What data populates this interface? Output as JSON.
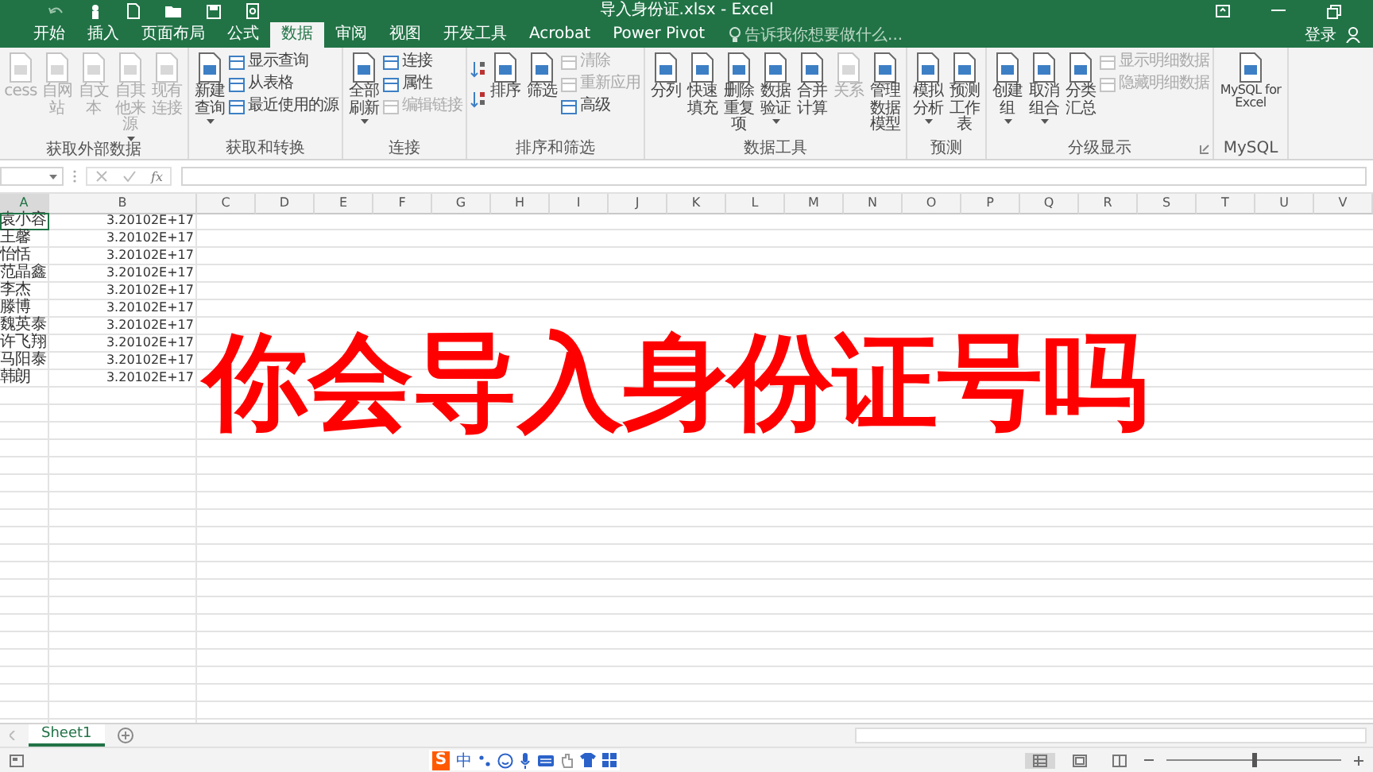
{
  "window": {
    "title": "导入身份证.xlsx - Excel"
  },
  "tabs": [
    {
      "label": "开始",
      "selected": false
    },
    {
      "label": "插入",
      "selected": false
    },
    {
      "label": "页面布局",
      "selected": false
    },
    {
      "label": "公式",
      "selected": false
    },
    {
      "label": "数据",
      "selected": true
    },
    {
      "label": "审阅",
      "selected": false
    },
    {
      "label": "视图",
      "selected": false
    },
    {
      "label": "开发工具",
      "selected": false
    },
    {
      "label": "Acrobat",
      "selected": false
    },
    {
      "label": "Power Pivot",
      "selected": false
    }
  ],
  "tell_me": {
    "placeholder": "告诉我你想要做什么..."
  },
  "sign_in": "登录",
  "ribbon": {
    "groups": [
      {
        "label": "获取外部数据",
        "items": [
          {
            "kind": "large",
            "label": "cess",
            "disabled": true
          },
          {
            "kind": "large",
            "label": "自网站",
            "disabled": true
          },
          {
            "kind": "large",
            "label": "自文本",
            "disabled": true
          },
          {
            "kind": "large",
            "label": "自其他来源",
            "disabled": true,
            "caret": true
          },
          {
            "kind": "large",
            "label": "现有连接",
            "disabled": true
          }
        ]
      },
      {
        "label": "获取和转换",
        "items": [
          {
            "kind": "large",
            "label": "新建查询",
            "disabled": false,
            "caret": true
          },
          {
            "kind": "stack",
            "items": [
              {
                "label": "显示查询",
                "disabled": false
              },
              {
                "label": "从表格",
                "disabled": false
              },
              {
                "label": "最近使用的源",
                "disabled": false
              }
            ]
          }
        ]
      },
      {
        "label": "连接",
        "items": [
          {
            "kind": "large",
            "label": "全部刷新",
            "disabled": false,
            "caret": true
          },
          {
            "kind": "stack",
            "items": [
              {
                "label": "连接",
                "disabled": false
              },
              {
                "label": "属性",
                "disabled": false
              },
              {
                "label": "编辑链接",
                "disabled": true
              }
            ]
          }
        ]
      },
      {
        "label": "排序和筛选",
        "items": [
          {
            "kind": "sort"
          },
          {
            "kind": "large",
            "label": "排序",
            "disabled": false
          },
          {
            "kind": "large",
            "label": "筛选",
            "disabled": false
          },
          {
            "kind": "stack",
            "items": [
              {
                "label": "清除",
                "disabled": true
              },
              {
                "label": "重新应用",
                "disabled": true
              },
              {
                "label": "高级",
                "disabled": false
              }
            ]
          }
        ]
      },
      {
        "label": "数据工具",
        "items": [
          {
            "kind": "large",
            "label": "分列",
            "disabled": false
          },
          {
            "kind": "large",
            "label": "快速填充",
            "disabled": false
          },
          {
            "kind": "large",
            "label": "删除重复项",
            "disabled": false
          },
          {
            "kind": "large",
            "label": "数据验证",
            "disabled": false,
            "caret": true
          },
          {
            "kind": "large",
            "label": "合并计算",
            "disabled": false
          },
          {
            "kind": "large",
            "label": "关系",
            "disabled": true
          },
          {
            "kind": "large",
            "label": "管理数据模型",
            "disabled": false
          }
        ]
      },
      {
        "label": "预测",
        "items": [
          {
            "kind": "large",
            "label": "模拟分析",
            "disabled": false,
            "caret": true
          },
          {
            "kind": "large",
            "label": "预测工作表",
            "disabled": false
          }
        ]
      },
      {
        "label": "分级显示",
        "launcher": true,
        "items": [
          {
            "kind": "large",
            "label": "创建组",
            "disabled": false,
            "caret": true
          },
          {
            "kind": "large",
            "label": "取消组合",
            "disabled": false,
            "caret": true
          },
          {
            "kind": "large",
            "label": "分类汇总",
            "disabled": false
          },
          {
            "kind": "stack",
            "items": [
              {
                "label": "显示明细数据",
                "disabled": true
              },
              {
                "label": "隐藏明细数据",
                "disabled": true
              }
            ]
          }
        ]
      },
      {
        "label": "MySQL",
        "items": [
          {
            "kind": "wide",
            "label": "MySQL for Excel",
            "disabled": false
          }
        ]
      }
    ]
  },
  "formula_bar": {
    "fx": "fx"
  },
  "columns": [
    {
      "label": "A",
      "selected": true
    },
    {
      "label": "B",
      "selected": false
    },
    {
      "label": "C",
      "selected": false
    },
    {
      "label": "D",
      "selected": false
    },
    {
      "label": "E",
      "selected": false
    },
    {
      "label": "F",
      "selected": false
    },
    {
      "label": "G",
      "selected": false
    },
    {
      "label": "H",
      "selected": false
    },
    {
      "label": "I",
      "selected": false
    },
    {
      "label": "J",
      "selected": false
    },
    {
      "label": "K",
      "selected": false
    },
    {
      "label": "L",
      "selected": false
    },
    {
      "label": "M",
      "selected": false
    },
    {
      "label": "N",
      "selected": false
    },
    {
      "label": "O",
      "selected": false
    },
    {
      "label": "P",
      "selected": false
    },
    {
      "label": "Q",
      "selected": false
    },
    {
      "label": "R",
      "selected": false
    },
    {
      "label": "S",
      "selected": false
    },
    {
      "label": "T",
      "selected": false
    },
    {
      "label": "U",
      "selected": false
    },
    {
      "label": "V",
      "selected": false
    }
  ],
  "rows": [
    {
      "name": "袁小容",
      "value": "3.20102E+17",
      "selected": true
    },
    {
      "name": "王馨",
      "value": "3.20102E+17",
      "selected": false
    },
    {
      "name": "怡恬",
      "value": "3.20102E+17",
      "selected": false
    },
    {
      "name": "范晶鑫",
      "value": "3.20102E+17",
      "selected": false
    },
    {
      "name": "李杰",
      "value": "3.20102E+17",
      "selected": false
    },
    {
      "name": "滕博",
      "value": "3.20102E+17",
      "selected": false
    },
    {
      "name": "魏英泰",
      "value": "3.20102E+17",
      "selected": false
    },
    {
      "name": "许飞翔",
      "value": "3.20102E+17",
      "selected": false
    },
    {
      "name": "马阳泰",
      "value": "3.20102E+17",
      "selected": false
    },
    {
      "name": "韩朗",
      "value": "3.20102E+17",
      "selected": false
    }
  ],
  "overlay_caption": "你会导入身份证号吗",
  "sheet_tabs": [
    {
      "label": "Sheet1",
      "selected": true
    }
  ],
  "ime_bar": {
    "logo": "S",
    "mode": "中"
  },
  "view_buttons": [
    {
      "selected": true
    },
    {
      "selected": false
    },
    {
      "selected": false
    }
  ],
  "zoom_slider": {
    "level": 0.5
  }
}
